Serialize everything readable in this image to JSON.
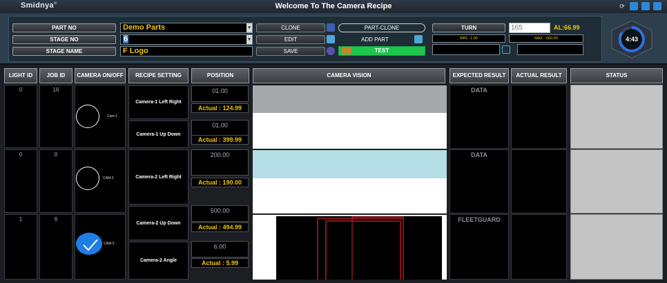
{
  "app": {
    "logo": "Smidnya",
    "title": "Welcome To The Camera Recipe"
  },
  "window_buttons": {
    "refresh": "⟳",
    "minimize": "▁",
    "maximize": "▭",
    "close": "✕"
  },
  "form": {
    "part_no_label": "PART NO",
    "stage_no_label": "STAGE NO",
    "stage_name_label": "STAGE NAME",
    "part_no_value": "Demo Parts",
    "stage_no_value": "6",
    "stage_name_value": "F Logo"
  },
  "actions": {
    "clone": "CLONE",
    "edit": "EDIT",
    "save": "SAVE",
    "part_clone": "PART-CLONE",
    "add_part": "ADD PART",
    "test": "TEST"
  },
  "turn": {
    "label": "TURN",
    "value": "165",
    "al": "AL:66.99",
    "min": "MIN - 1.00",
    "max": "MAX - 650.00"
  },
  "timer": {
    "value": "4:43"
  },
  "headers": {
    "light_id": "LIGHT ID",
    "job_id": "JOB ID",
    "camera": "CAMERA ON/OFF",
    "recipe": "RECIPE SETTING",
    "position": "POSITION",
    "vision": "CAMERA VISION",
    "expected": "EXPECTED RESULT",
    "actual": "ACTUAL RESULT",
    "status": "STATUS"
  },
  "rows": [
    {
      "light_id": "0",
      "job_id": "16",
      "cam": "Cam-1",
      "expected": "DATA"
    },
    {
      "light_id": "0",
      "job_id": "0",
      "cam": "CAM-2",
      "expected": "DATA"
    },
    {
      "light_id": "1",
      "job_id": "6",
      "cam": "CAM-3",
      "expected": "FLEETGUARD"
    }
  ],
  "recipes": [
    "Camera-1 Left Right",
    "Camera-1 Up Down",
    "Camera-2 Left Right",
    "Camera-2 Up Down",
    "Camera-2 Angle"
  ],
  "positions": [
    {
      "set": "01.00",
      "actual": "Actual : 124.99"
    },
    {
      "set": "01.00",
      "actual": "Actual : 399.99"
    },
    {
      "set": "200.00",
      "actual": "Actual : 190.00"
    },
    {
      "set": "500.00",
      "actual": "Actual : 494.99"
    },
    {
      "set": "6.00",
      "actual": "Actual : 5.99"
    }
  ],
  "colors": {
    "accent": "#f1c40f",
    "test_button": "#1ec64b",
    "timer_ring": "#2d6fe0"
  }
}
